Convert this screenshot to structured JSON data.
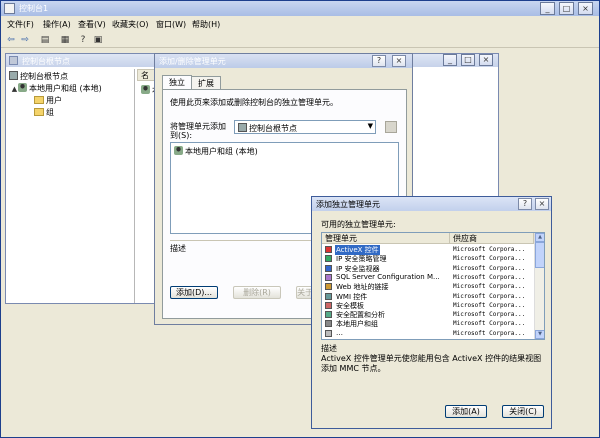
{
  "window": {
    "title": "控制台1"
  },
  "menu": [
    "文件(F)",
    "操作(A)",
    "查看(V)",
    "收藏夹(O)",
    "窗口(W)",
    "帮助(H)"
  ],
  "child": {
    "title": "控制台根节点",
    "tree": {
      "root": "控制台根节点",
      "node": "本地用户和组 (本地)",
      "children": [
        "用户",
        "组"
      ]
    },
    "list_header": "名",
    "list_item": "本"
  },
  "addremove": {
    "title": "添加/删除管理单元",
    "tabs": [
      "独立",
      "扩展"
    ],
    "instruction": "使用此页来添加或删除控制台的独立管理单元。",
    "addto_label_1": "将管理单元添加",
    "addto_label_2": "到(S):",
    "addto_value": "控制台根节点",
    "snapin_item": "本地用户和组 (本地)",
    "desc_label": "描述",
    "buttons": {
      "add": "添加(D)...",
      "remove": "删除(R)",
      "about": "关于(B)"
    }
  },
  "add_standalone": {
    "title": "添加独立管理单元",
    "available_label": "可用的独立管理单元:",
    "columns": [
      "管理单元",
      "供应商"
    ],
    "rows": [
      {
        "name": "ActiveX 控件",
        "vendor": "Microsoft Corpora...",
        "selected": true
      },
      {
        "name": "IP 安全策略管理",
        "vendor": "Microsoft Corpora..."
      },
      {
        "name": "IP 安全监视器",
        "vendor": "Microsoft Corpora..."
      },
      {
        "name": "SQL Server Configuration M...",
        "vendor": "Microsoft Corpora..."
      },
      {
        "name": "Web 地址的链接",
        "vendor": "Microsoft Corpora..."
      },
      {
        "name": "WMI 控件",
        "vendor": "Microsoft Corpora..."
      },
      {
        "name": "安全模板",
        "vendor": "Microsoft Corpora..."
      },
      {
        "name": "安全配置和分析",
        "vendor": "Microsoft Corpora..."
      },
      {
        "name": "本地用户和组",
        "vendor": "Microsoft Corpora..."
      },
      {
        "name": "…",
        "vendor": "Microsoft Corpora..."
      }
    ],
    "desc_label": "描述",
    "desc_text": "ActiveX 控件管理单元使您能用包含 ActiveX 控件的结果视图添加 MMC 节点。",
    "buttons": {
      "add": "添加(A)",
      "close": "关闭(C)"
    }
  }
}
